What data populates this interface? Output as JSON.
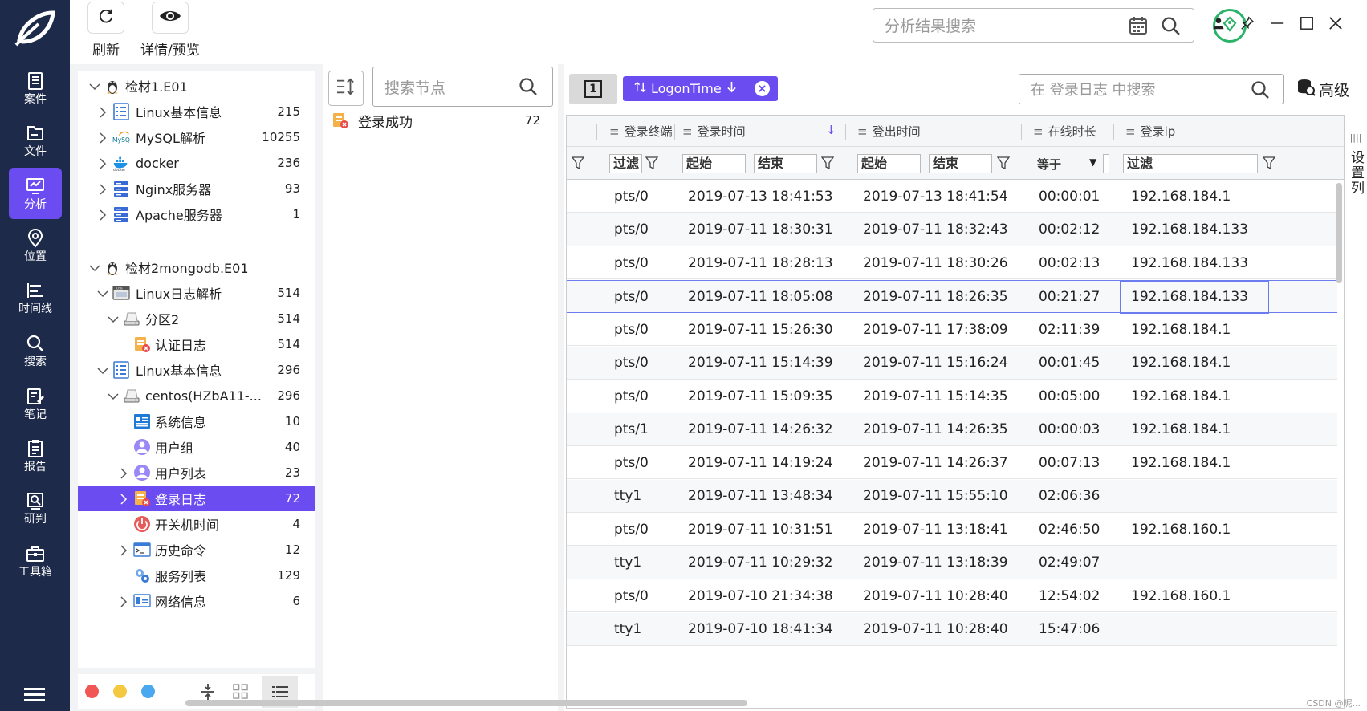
{
  "topbar": {
    "refresh_label": "刷新",
    "details_label": "详情/预览",
    "search_placeholder": "分析结果搜索"
  },
  "sidebar": {
    "items": [
      {
        "label": "案件",
        "icon": "case-icon"
      },
      {
        "label": "文件",
        "icon": "folder-icon"
      },
      {
        "label": "分析",
        "icon": "analysis-icon",
        "active": true
      },
      {
        "label": "位置",
        "icon": "location-icon"
      },
      {
        "label": "时间线",
        "icon": "timeline-icon"
      },
      {
        "label": "搜索",
        "icon": "search-icon"
      },
      {
        "label": "笔记",
        "icon": "note-icon"
      },
      {
        "label": "报告",
        "icon": "report-icon"
      },
      {
        "label": "研判",
        "icon": "judge-icon"
      },
      {
        "label": "工具箱",
        "icon": "toolbox-icon"
      }
    ]
  },
  "tree": {
    "rows": [
      {
        "label": "检材1.E01",
        "count": "",
        "level": 0,
        "chev": "down",
        "icon": "linux-icon"
      },
      {
        "label": "Linux基本信息",
        "count": "215",
        "level": 1,
        "chev": "right",
        "icon": "list-doc-icon"
      },
      {
        "label": "MySQL解析",
        "count": "10255",
        "level": 1,
        "chev": "right",
        "icon": "mysql-icon"
      },
      {
        "label": "docker",
        "count": "236",
        "level": 1,
        "chev": "right",
        "icon": "docker-icon"
      },
      {
        "label": "Nginx服务器",
        "count": "93",
        "level": 1,
        "chev": "right",
        "icon": "server-icon"
      },
      {
        "label": "Apache服务器",
        "count": "1",
        "level": 1,
        "chev": "right",
        "icon": "server-icon"
      },
      {
        "label": "检材2mongodb.E01",
        "count": "",
        "level": 0,
        "chev": "down",
        "icon": "linux-icon"
      },
      {
        "label": "Linux日志解析",
        "count": "514",
        "level": 1,
        "chev": "down",
        "icon": "log-icon"
      },
      {
        "label": "分区2",
        "count": "514",
        "level": 2,
        "chev": "down",
        "icon": "disk-icon"
      },
      {
        "label": "认证日志",
        "count": "514",
        "level": 3,
        "chev": "",
        "icon": "auth-log-icon"
      },
      {
        "label": "Linux基本信息",
        "count": "296",
        "level": 1,
        "chev": "down",
        "icon": "list-doc-icon"
      },
      {
        "label": "centos(HZbA11-...",
        "count": "296",
        "level": 2,
        "chev": "down",
        "icon": "disk-icon"
      },
      {
        "label": "系统信息",
        "count": "10",
        "level": 3,
        "chev": "",
        "icon": "sysinfo-icon"
      },
      {
        "label": "用户组",
        "count": "40",
        "level": 3,
        "chev": "",
        "icon": "usergroup-icon"
      },
      {
        "label": "用户列表",
        "count": "23",
        "level": 3,
        "chev": "right",
        "icon": "user-icon"
      },
      {
        "label": "登录日志",
        "count": "72",
        "level": 3,
        "chev": "right",
        "icon": "login-log-icon",
        "selected": true
      },
      {
        "label": "开关机时间",
        "count": "4",
        "level": 3,
        "chev": "",
        "icon": "power-icon"
      },
      {
        "label": "历史命令",
        "count": "12",
        "level": 3,
        "chev": "right",
        "icon": "terminal-icon"
      },
      {
        "label": "服务列表",
        "count": "129",
        "level": 3,
        "chev": "",
        "icon": "services-icon"
      },
      {
        "label": "网络信息",
        "count": "6",
        "level": 3,
        "chev": "right",
        "icon": "network-icon"
      }
    ],
    "footer_dots": [
      "#f05656",
      "#f5c842",
      "#4aa8f0"
    ]
  },
  "middle": {
    "search_placeholder": "搜索节点",
    "item_label": "登录成功",
    "item_count": "72"
  },
  "main": {
    "page_number": "1",
    "chip_label": "LogonTime",
    "search_placeholder": "在 登录日志 中搜索",
    "advanced_label": "高级",
    "set_columns_label": "设置列",
    "columns": [
      "登录终端",
      "登录时间",
      "登出时间",
      "在线时长",
      "登录ip"
    ],
    "filters": {
      "terminal": "过滤",
      "login_start": "起始",
      "login_end": "结束",
      "logout_start": "起始",
      "logout_end": "结束",
      "duration_op": "等于",
      "ip": "过滤"
    },
    "rows": [
      {
        "terminal": "pts/0",
        "login": "2019-07-13 18:41:53",
        "logout": "2019-07-13 18:41:54",
        "duration": "00:00:01",
        "ip": "192.168.184.1"
      },
      {
        "terminal": "pts/0",
        "login": "2019-07-11 18:30:31",
        "logout": "2019-07-11 18:32:43",
        "duration": "00:02:12",
        "ip": "192.168.184.133"
      },
      {
        "terminal": "pts/0",
        "login": "2019-07-11 18:28:13",
        "logout": "2019-07-11 18:30:26",
        "duration": "00:02:13",
        "ip": "192.168.184.133"
      },
      {
        "terminal": "pts/0",
        "login": "2019-07-11 18:05:08",
        "logout": "2019-07-11 18:26:35",
        "duration": "00:21:27",
        "ip": "192.168.184.133"
      },
      {
        "terminal": "pts/0",
        "login": "2019-07-11 15:26:30",
        "logout": "2019-07-11 17:38:09",
        "duration": "02:11:39",
        "ip": "192.168.184.1"
      },
      {
        "terminal": "pts/0",
        "login": "2019-07-11 15:14:39",
        "logout": "2019-07-11 15:16:24",
        "duration": "00:01:45",
        "ip": "192.168.184.1"
      },
      {
        "terminal": "pts/0",
        "login": "2019-07-11 15:09:35",
        "logout": "2019-07-11 15:14:35",
        "duration": "00:05:00",
        "ip": "192.168.184.1"
      },
      {
        "terminal": "pts/1",
        "login": "2019-07-11 14:26:32",
        "logout": "2019-07-11 14:26:35",
        "duration": "00:00:03",
        "ip": "192.168.184.1"
      },
      {
        "terminal": "pts/0",
        "login": "2019-07-11 14:19:24",
        "logout": "2019-07-11 14:26:37",
        "duration": "00:07:13",
        "ip": "192.168.184.1"
      },
      {
        "terminal": "tty1",
        "login": "2019-07-11 13:48:34",
        "logout": "2019-07-11 15:55:10",
        "duration": "02:06:36",
        "ip": ""
      },
      {
        "terminal": "pts/0",
        "login": "2019-07-11 10:31:51",
        "logout": "2019-07-11 13:18:41",
        "duration": "02:46:50",
        "ip": "192.168.160.1"
      },
      {
        "terminal": "tty1",
        "login": "2019-07-11 10:29:32",
        "logout": "2019-07-11 13:18:39",
        "duration": "02:49:07",
        "ip": ""
      },
      {
        "terminal": "pts/0",
        "login": "2019-07-10 21:34:38",
        "logout": "2019-07-11 10:28:40",
        "duration": "12:54:02",
        "ip": "192.168.160.1"
      },
      {
        "terminal": "tty1",
        "login": "2019-07-10 18:41:34",
        "logout": "2019-07-11 10:28:40",
        "duration": "15:47:06",
        "ip": ""
      }
    ]
  },
  "watermark": "CSDN @昵...",
  "colors": {
    "sidebar_bg": "#1e2a4a",
    "accent": "#6a4cf0",
    "badge_green": "#2bb36a"
  }
}
